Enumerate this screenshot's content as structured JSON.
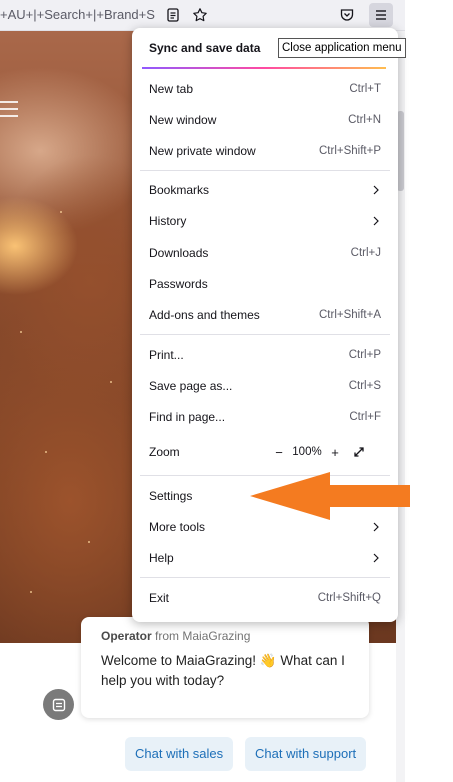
{
  "browser": {
    "url_fragment": "+AU+|+Search+|+Brand+S"
  },
  "menu": {
    "sync_title": "Sync and save data",
    "tooltip": "Close application menu",
    "items": [
      {
        "label": "New tab",
        "shortcut": "Ctrl+T"
      },
      {
        "label": "New window",
        "shortcut": "Ctrl+N"
      },
      {
        "label": "New private window",
        "shortcut": "Ctrl+Shift+P"
      },
      {
        "label": "Bookmarks",
        "shortcut": ""
      },
      {
        "label": "History",
        "shortcut": ""
      },
      {
        "label": "Downloads",
        "shortcut": "Ctrl+J"
      },
      {
        "label": "Passwords",
        "shortcut": ""
      },
      {
        "label": "Add-ons and themes",
        "shortcut": "Ctrl+Shift+A"
      },
      {
        "label": "Print...",
        "shortcut": "Ctrl+P"
      },
      {
        "label": "Save page as...",
        "shortcut": "Ctrl+S"
      },
      {
        "label": "Find in page...",
        "shortcut": "Ctrl+F"
      },
      {
        "label": "Zoom",
        "shortcut": ""
      },
      {
        "label": "Settings",
        "shortcut": ""
      },
      {
        "label": "More tools",
        "shortcut": ""
      },
      {
        "label": "Help",
        "shortcut": ""
      },
      {
        "label": "Exit",
        "shortcut": "Ctrl+Shift+Q"
      }
    ],
    "zoom_level": "100%",
    "zoom_minus": "−",
    "zoom_plus": "+"
  },
  "chat": {
    "operator_name": "Operator",
    "operator_from": " from MaiaGrazing",
    "message": "Welcome to MaiaGrazing! 👋 What can I help you with today?",
    "buttons": [
      "Chat with sales",
      "Chat with support"
    ]
  },
  "annotation": {
    "arrow_color": "#f47b20"
  }
}
